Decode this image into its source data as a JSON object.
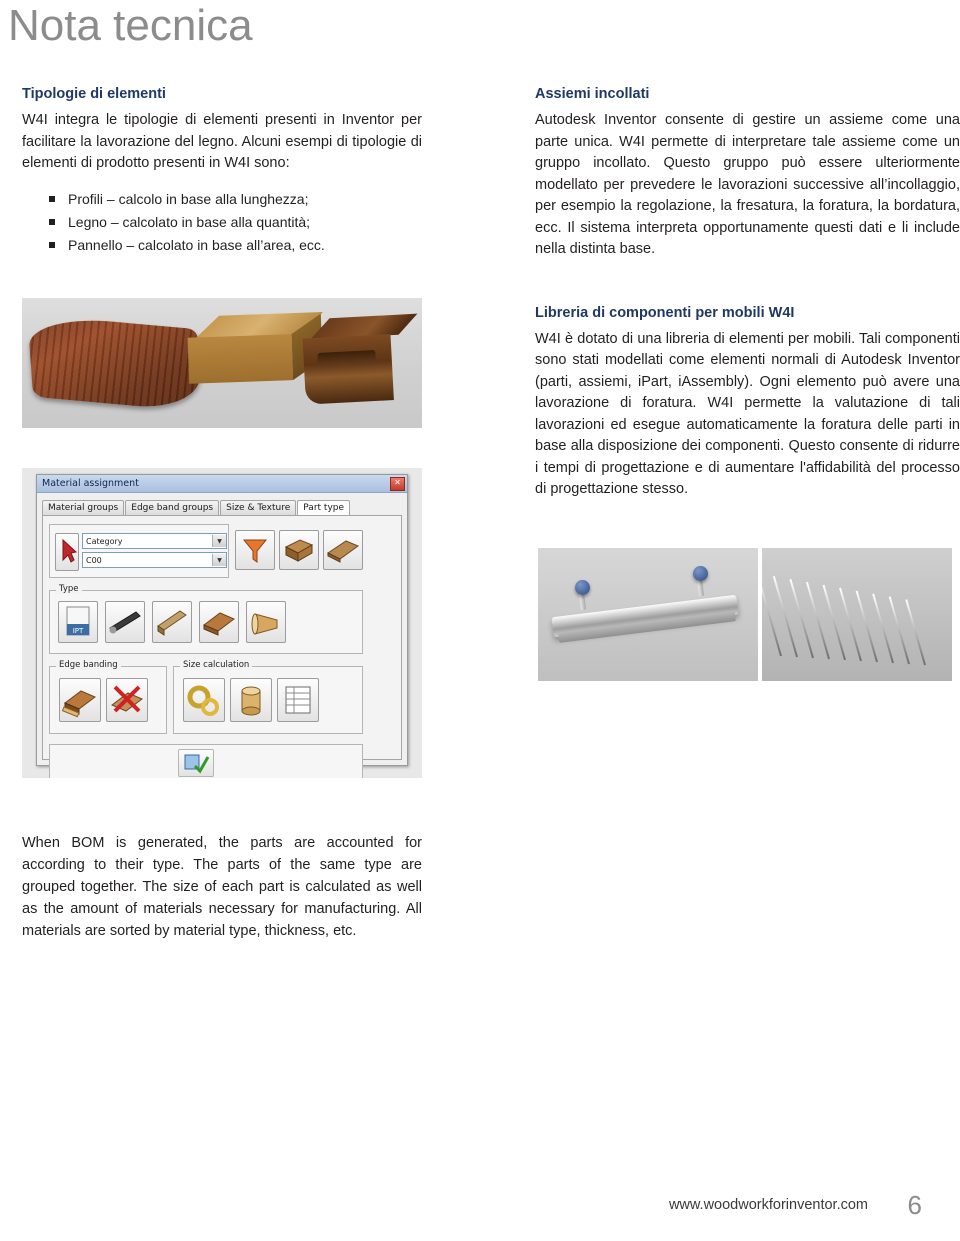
{
  "document": {
    "title": "Nota tecnica"
  },
  "left_column": {
    "section_title": "Tipologie di elementi",
    "paragraph": "W4I integra le tipologie di elementi presenti in Inventor per facilitare la lavorazione del legno. Alcuni esempi di tipologie di elementi di prodotto presenti in W4I sono:",
    "bullets": [
      "Profili – calcolo in base alla lunghezza;",
      "Legno – calcolato in base alla quantità;",
      "Pannello – calcolato in base all’area, ecc."
    ]
  },
  "right_column": {
    "section1_title": "Assiemi incollati",
    "section1_text": "Autodesk Inventor consente di gestire un assieme come una parte unica. W4I permette di interpretare tale assieme come un gruppo incollato. Questo gruppo può essere ulteriormente modellato per prevedere le lavorazioni successive all’incollaggio, per esempio la regolazione, la fresatura, la foratura, la bordatura, ecc. Il sistema interpreta opportunamente questi dati e li include nella distinta base.",
    "section2_title": "Libreria di componenti per mobili W4I",
    "section2_text": "W4I è dotato di una libreria di elementi per mobili. Tali componenti sono stati modellati come elementi normali di Autodesk Inventor (parti, assiemi, iPart, iAssembly). Ogni elemento può avere una lavorazione di foratura. W4I permette la valutazione di tali lavorazioni ed esegue automaticamente la foratura delle parti in base alla disposizione dei componenti. Questo consente di ridurre i tempi di progettazione e di aumentare l'affidabilità del processo di progettazione stesso."
  },
  "bottom_text": "When BOM is generated, the parts are accounted for according to their type. The parts of the same type are grouped together. The size of each part is calculated as well as the amount of materials necessary for manufacturing. All materials are sorted by material type, thickness, etc.",
  "dialog": {
    "title": "Material assignment",
    "close_label": "✕",
    "tabs": [
      "Material groups",
      "Edge band groups",
      "Size & Texture",
      "Part type"
    ],
    "active_tab": "Part type",
    "category_combo": "Category",
    "code_combo": "C00",
    "groups": {
      "type": "Type",
      "edge_banding": "Edge banding",
      "size_calculation": "Size calculation"
    },
    "ipt_label": "IPT"
  },
  "footer": {
    "url": "www.woodworkforinventor.com",
    "page": "6"
  },
  "colors": {
    "title_gray": "#8c8c8c",
    "heading_blue": "#1f3864",
    "body_text": "#231f20"
  }
}
